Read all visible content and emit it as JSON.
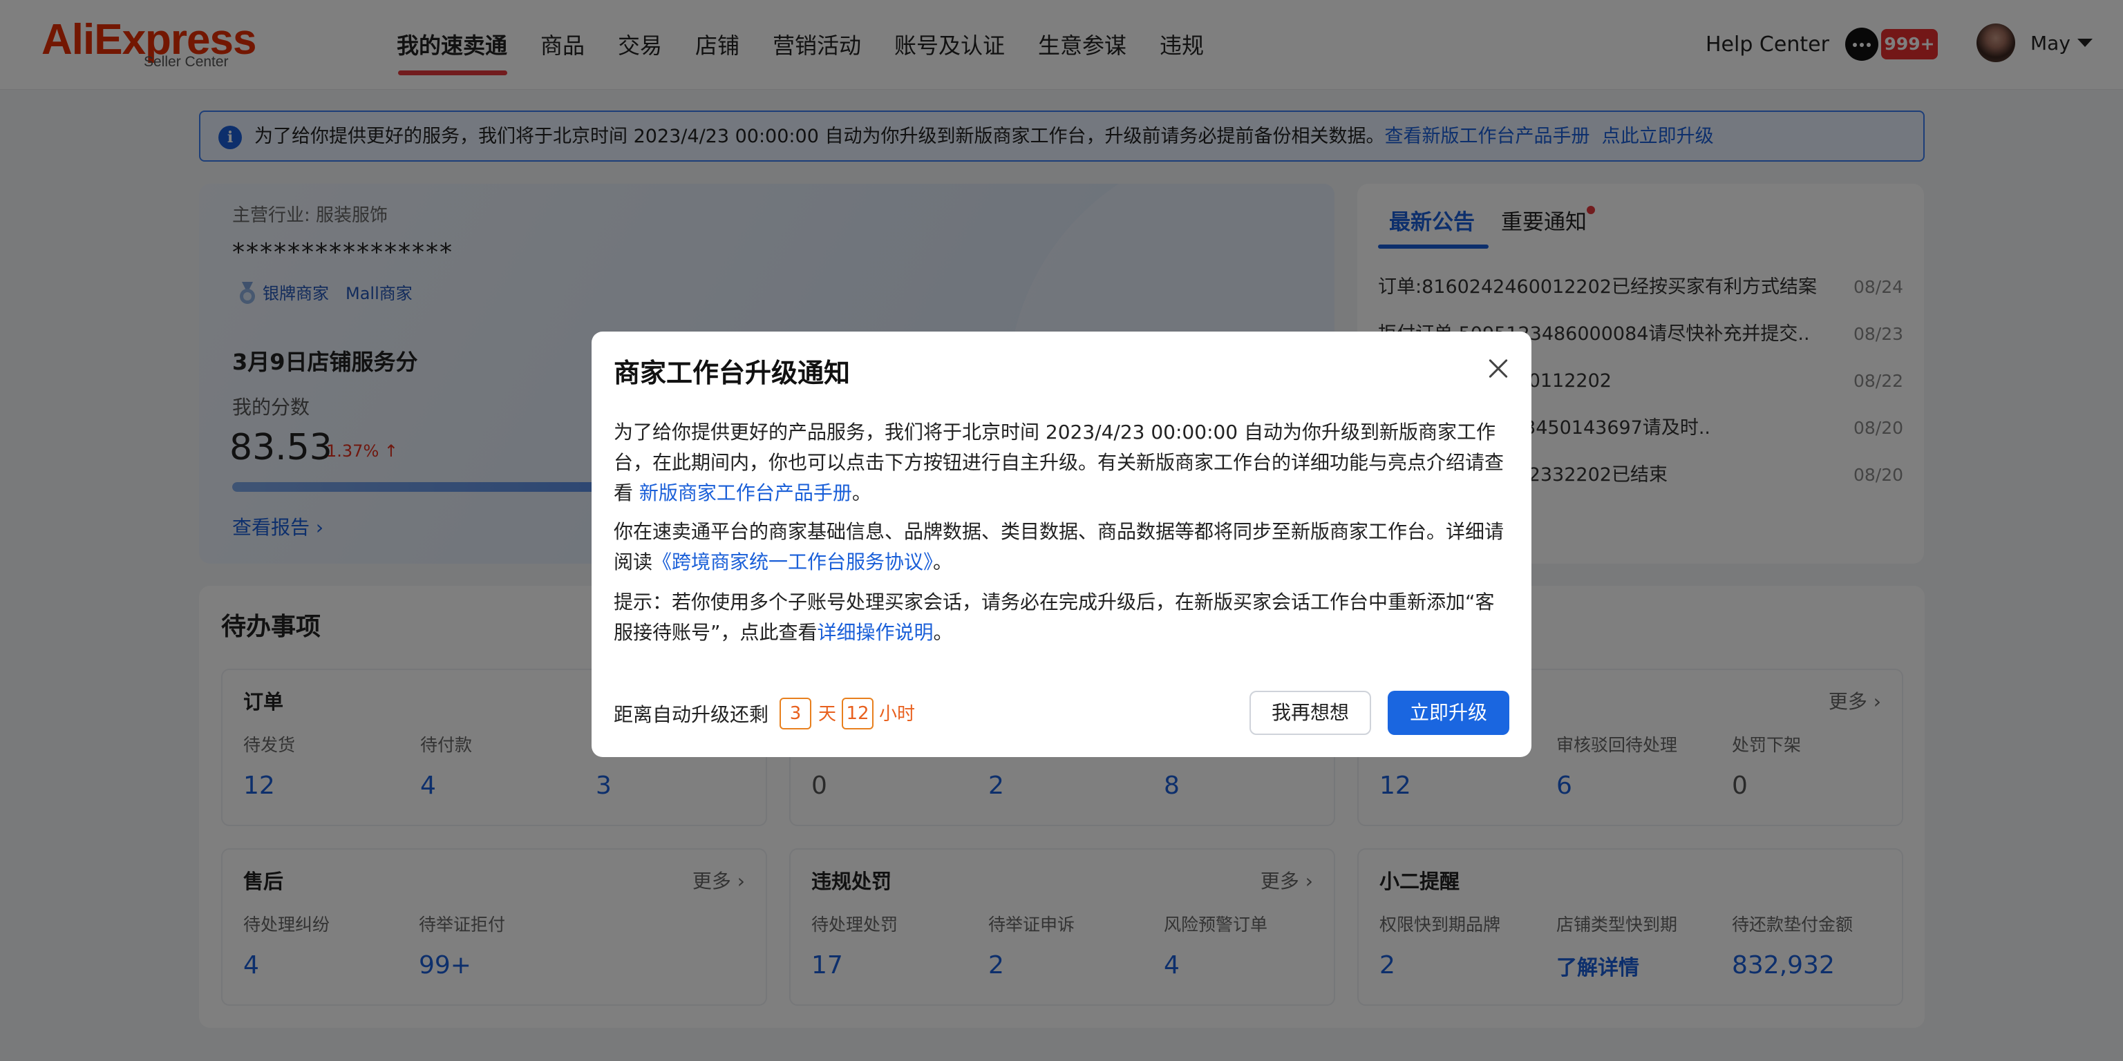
{
  "header": {
    "logo_main": "AliExpress",
    "logo_sub": "Seller Center",
    "nav": [
      "我的速卖通",
      "商品",
      "交易",
      "店铺",
      "营销活动",
      "账号及认证",
      "生意参谋",
      "违规"
    ],
    "help_center": "Help Center",
    "msg_badge": "999+",
    "user_name": "May"
  },
  "banner": {
    "text": "为了给你提供更好的服务，我们将于北京时间 2023/4/23 00:00:00 自动为你升级到新版商家工作台，升级前请务必提前备份相关数据。",
    "link1": "查看新版工作台产品手册",
    "link2": "点此立即升级"
  },
  "store": {
    "industry": "主营行业: 服装服饰",
    "name": "****************",
    "tag_silver": "银牌商家",
    "tag_mall": "Mall商家",
    "score_title": "3月9日店铺服务分",
    "score_label": "我的分数",
    "score_value": "83.53",
    "score_change": "1.37% ↑",
    "view_report": "查看报告 ›"
  },
  "notices": {
    "tab_latest": "最新公告",
    "tab_important": "重要通知",
    "items": [
      {
        "title": "订单:8160242460012202已经按买家有利方式结案",
        "date": "08/24"
      },
      {
        "title": "拒付订单 5095123486000084请尽快补充并提交..",
        "date": "08/23"
      },
      {
        "title": "订单:8160038070112202",
        "date": "08/22"
      },
      {
        "title": "拒付订单8159213450143697请及时..",
        "date": "08/20"
      },
      {
        "title": "订单:8159935582332202已结束",
        "date": "08/20"
      }
    ]
  },
  "todo": {
    "title": "待办事项",
    "more": "更多 ›",
    "order": {
      "title": "订单",
      "labels": [
        "待发货",
        "待付款",
        ""
      ],
      "values": [
        "12",
        "4",
        "3"
      ]
    },
    "mid": {
      "labels": [
        "",
        "",
        ""
      ],
      "values": [
        "0",
        "2",
        "8"
      ]
    },
    "right": {
      "labels": [
        "",
        "审核驳回待处理",
        "处罚下架"
      ],
      "values": [
        "12",
        "6",
        "0"
      ]
    },
    "aftersale": {
      "title": "售后",
      "labels": [
        "待处理纠纷",
        "待举证拒付"
      ],
      "values": [
        "4",
        "99+"
      ]
    },
    "violation": {
      "title": "违规处罚",
      "labels": [
        "待处理处罚",
        "待举证申诉",
        "风险预警订单"
      ],
      "values": [
        "17",
        "2",
        "4"
      ]
    },
    "reminder": {
      "title": "小二提醒",
      "labels": [
        "权限快到期品牌",
        "店铺类型快到期",
        "待还款垫付金额"
      ],
      "values": [
        "2",
        "了解详情",
        "832,932"
      ]
    }
  },
  "modal": {
    "title": "商家工作台升级通知",
    "p1a": "为了给你提供更好的产品服务，我们将于北京时间 2023/4/23 00:00:00 自动为你升级到新版商家工作台，在此期间内，你也可以点击下方按钮进行自主升级。有关新版商家工作台的详细功能与亮点介绍请查看 ",
    "p1_link": "新版商家工作台产品手册",
    "p1b": "。",
    "p2a": "你在速卖通平台的商家基础信息、品牌数据、类目数据、商品数据等都将同步至新版商家工作台。详细请阅读",
    "p2_link": "《跨境商家统一工作台服务协议》",
    "p2b": "。",
    "p3a": "提示：若你使用多个子账号处理买家会话，请务必在完成升级后，在新版买家会话工作台中重新添加“客服接待账号”，点此查看",
    "p3_link": "详细操作说明",
    "p3b": "。",
    "countdown_label": "距离自动升级还剩",
    "days": "3",
    "days_unit": "天",
    "hours": "12",
    "hours_unit": "小时",
    "btn_later": "我再想想",
    "btn_upgrade": "立即升级"
  },
  "score_progress": 0.83,
  "colors": {
    "brand": "#e62e04",
    "accent": "#1a5fd8",
    "countdown": "#e8601e"
  }
}
